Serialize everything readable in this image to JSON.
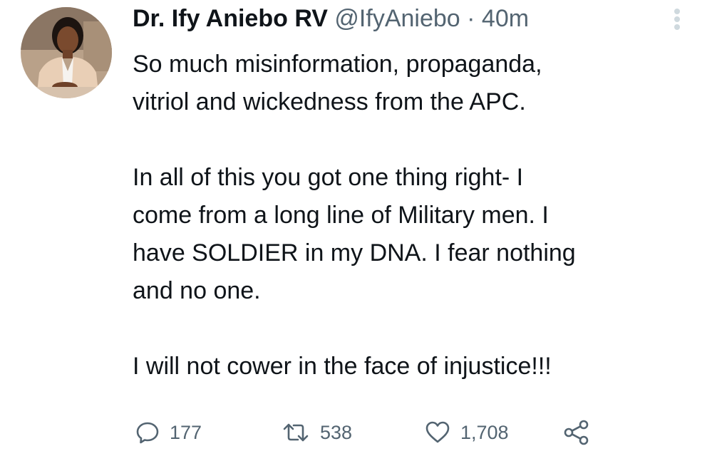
{
  "tweet": {
    "display_name": "Dr. Ify Aniebo RV",
    "handle": "@IfyAniebo",
    "separator": "·",
    "time": "40m",
    "paragraphs": [
      [
        "So much misinformation, propaganda,",
        "vitriol and wickedness from the APC."
      ],
      [
        "In all of this you got one thing right- I",
        "come from a long line of Military men. I",
        "have SOLDIER in my DNA. I fear nothing",
        "and no one."
      ],
      [
        "I will not cower in the face of injustice!!!"
      ]
    ],
    "actions": {
      "reply_count": "177",
      "retweet_count": "538",
      "like_count": "1,708"
    },
    "icons": {
      "avatar": "profile-photo",
      "more": "more-vertical-icon",
      "reply": "reply-icon",
      "retweet": "retweet-icon",
      "like": "heart-icon",
      "share": "share-icon"
    }
  },
  "colors": {
    "text_primary": "#0f1419",
    "text_secondary": "#536471",
    "more_dots": "#cfd9de"
  }
}
